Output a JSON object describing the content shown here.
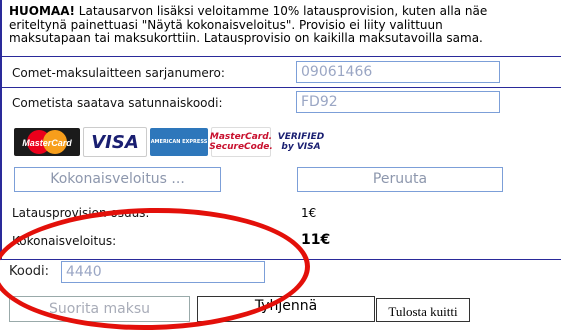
{
  "notice": {
    "bold": "HUOMAA!",
    "text": " Latausarvon lisäksi veloitamme 10% latausprovision, kuten alla näe\neriteltynä painettuasi \"Näytä kokonaisveloitus\". Provisio ei liity valittuun\nmaksutapaan tai maksukorttiin. Latausprovisio on kaikilla maksutavoilla sama."
  },
  "serial": {
    "label": "Comet-maksulaitteen sarjanumero:",
    "value": "09061466"
  },
  "random_code": {
    "label": "Cometista saatava satunnaiskoodi:",
    "value": "FD92"
  },
  "cards": [
    {
      "icon": "mastercard-logo",
      "text": "MasterCard"
    },
    {
      "icon": "visa-logo",
      "text": "VISA"
    },
    {
      "icon": "amex-logo",
      "text": "AMERICAN EXPRESS"
    },
    {
      "icon": "mastercard-securecode-logo",
      "text": "MasterCard. SecureCode."
    },
    {
      "icon": "verified-by-visa-logo",
      "text": "VERIFIED by VISA"
    }
  ],
  "buttons": {
    "total": "Kokonaisveloitus ...",
    "cancel": "Peruuta",
    "pay": "Suorita maksu",
    "clear": "Tyhjennä",
    "print": "Tulosta kuitti"
  },
  "commission": {
    "label": "Latausprovision osuus:",
    "value": "1€"
  },
  "total": {
    "label": "Kokonaisveloitus:",
    "value": "11€"
  },
  "code": {
    "label": "Koodi:",
    "value": "4440"
  },
  "colors": {
    "accent": "#2a2a9a",
    "highlight_ring": "#e3100a",
    "input_border": "#7c9fd8"
  }
}
